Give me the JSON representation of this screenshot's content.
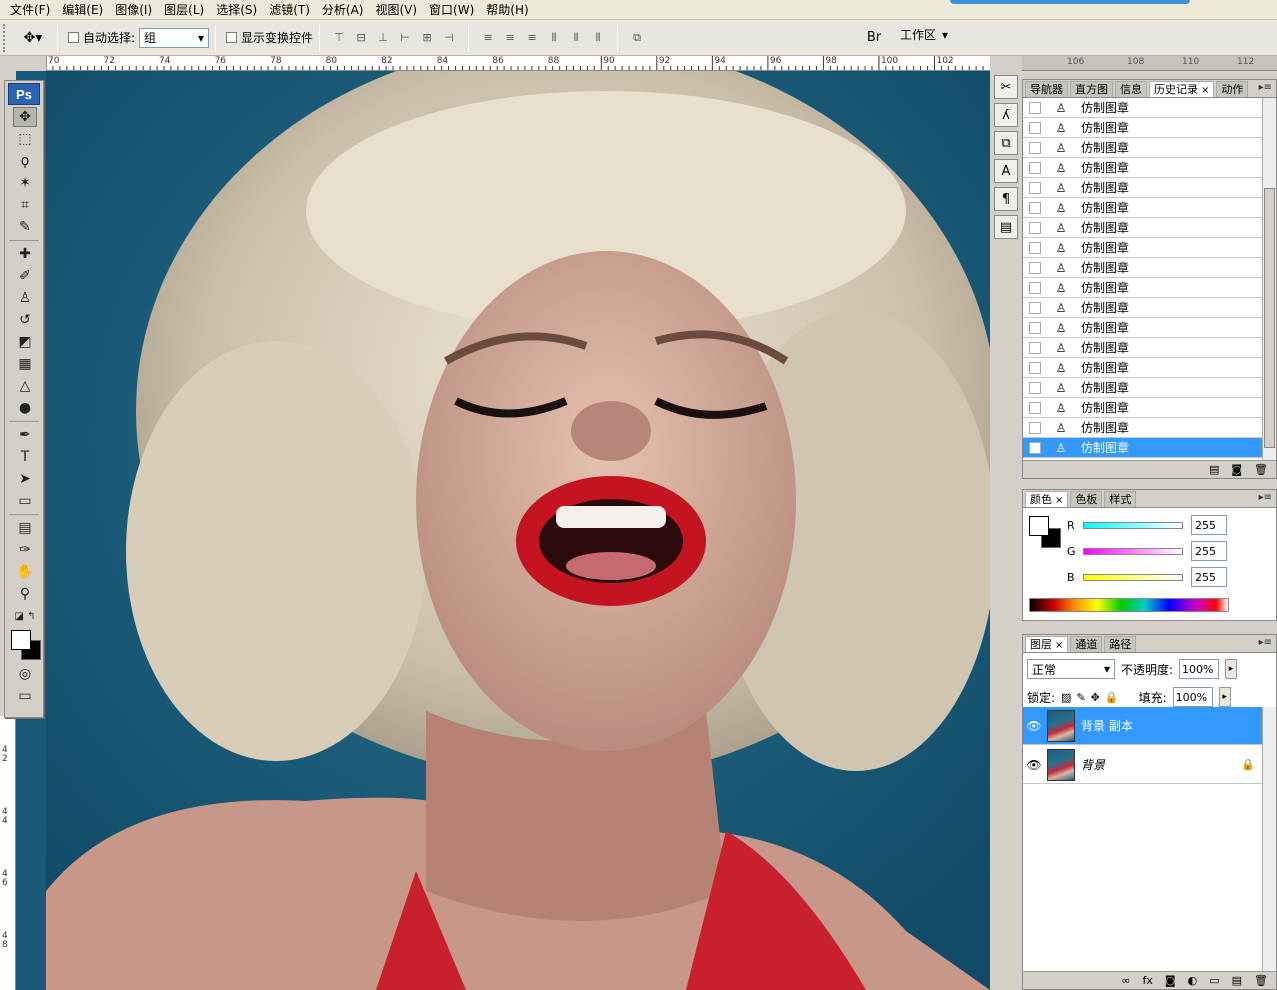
{
  "menu": [
    "文件(F)",
    "编辑(E)",
    "图像(I)",
    "图层(L)",
    "选择(S)",
    "滤镜(T)",
    "分析(A)",
    "视图(V)",
    "窗口(W)",
    "帮助(H)"
  ],
  "options": {
    "auto_select_label": "自动选择:",
    "auto_select_value": "组",
    "show_transform_label": "显示变换控件",
    "workspace_label": "工作区"
  },
  "ruler_h": [
    "70",
    "72",
    "74",
    "76",
    "78",
    "80",
    "82",
    "84",
    "86",
    "88",
    "90",
    "92",
    "94",
    "96",
    "98",
    "100",
    "102"
  ],
  "ruler_v": [
    "4\n2",
    "4\n4",
    "4\n6",
    "4\n8"
  ],
  "ruler_right": [
    "106",
    "108",
    "110",
    "112"
  ],
  "toolbox": {
    "logo": "Ps"
  },
  "history": {
    "tabs": [
      "导航器",
      "直方图",
      "信息",
      "历史记录",
      "动作"
    ],
    "items": [
      "仿制图章",
      "仿制图章",
      "仿制图章",
      "仿制图章",
      "仿制图章",
      "仿制图章",
      "仿制图章",
      "仿制图章",
      "仿制图章",
      "仿制图章",
      "仿制图章",
      "仿制图章",
      "仿制图章",
      "仿制图章",
      "仿制图章",
      "仿制图章",
      "仿制图章",
      "仿制图章"
    ],
    "selected_index": 17
  },
  "color": {
    "tabs": [
      "颜色",
      "色板",
      "样式"
    ],
    "channels": [
      {
        "label": "R",
        "value": "255",
        "gradient": "#00ffff"
      },
      {
        "label": "G",
        "value": "255",
        "gradient": "#ff00ff"
      },
      {
        "label": "B",
        "value": "255",
        "gradient": "#ffff00"
      }
    ]
  },
  "layers": {
    "tabs": [
      "图层",
      "通道",
      "路径"
    ],
    "blend_mode": "正常",
    "opacity_label": "不透明度:",
    "opacity_value": "100%",
    "lock_label": "锁定:",
    "fill_label": "填充:",
    "fill_value": "100%",
    "items": [
      {
        "name": "背景 副本",
        "selected": true
      },
      {
        "name": "背景",
        "selected": false,
        "locked": true
      }
    ]
  },
  "colors": {
    "selection": "#3399ff",
    "ps_blue": "#2b63b4",
    "canvas_bg": "#1a5a78"
  }
}
